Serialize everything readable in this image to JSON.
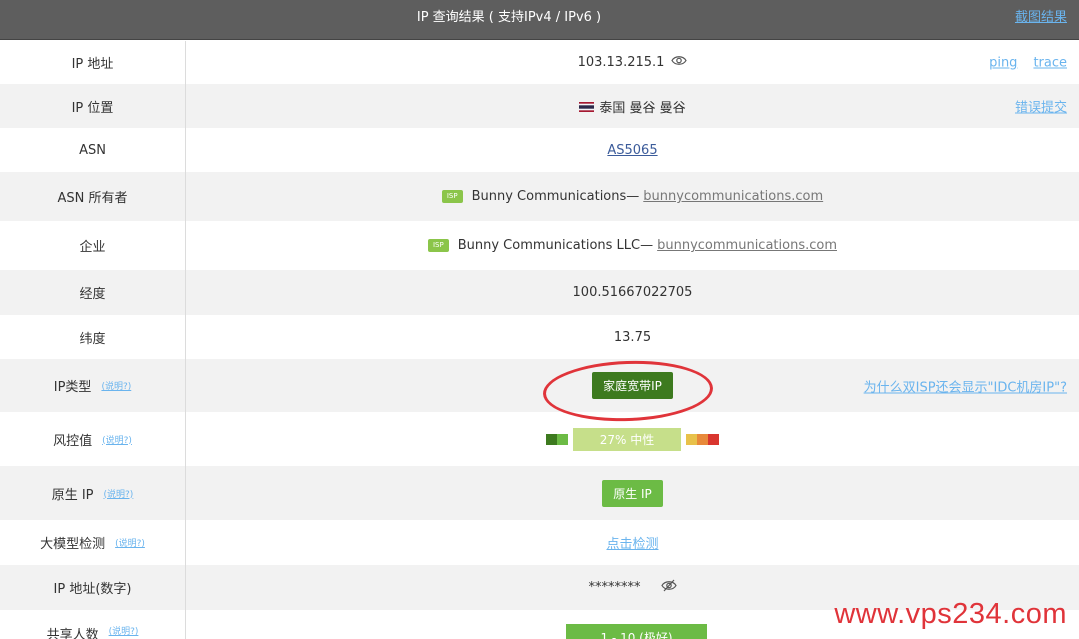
{
  "header": {
    "title": "IP 查询结果 ( 支持IPv4 / IPv6 )",
    "screenshot_link": "截图结果"
  },
  "rows": {
    "ip": {
      "label": "IP 地址",
      "value": "103.13.215.1",
      "ping": "ping",
      "trace": "trace"
    },
    "location": {
      "label": "IP 位置",
      "value": "泰国 曼谷 曼谷",
      "report": "错误提交"
    },
    "asn": {
      "label": "ASN",
      "value": "AS5065"
    },
    "asn_owner": {
      "label": "ASN 所有者",
      "badge": "ISP",
      "name": "Bunny Communications—",
      "domain": "bunnycommunications.com"
    },
    "company": {
      "label": "企业",
      "badge": "ISP",
      "name": "Bunny Communications LLC—",
      "domain": "bunnycommunications.com"
    },
    "longitude": {
      "label": "经度",
      "value": "100.51667022705"
    },
    "latitude": {
      "label": "纬度",
      "value": "13.75"
    },
    "ip_type": {
      "label": "IP类型",
      "help": "(说明?)",
      "value": "家庭宽带IP",
      "why_link": "为什么双ISP还会显示\"IDC机房IP\"?"
    },
    "risk": {
      "label": "风控值",
      "help": "(说明?)",
      "value": "27%  中性"
    },
    "native": {
      "label": "原生 IP",
      "help": "(说明?)",
      "value": "原生 IP"
    },
    "llm": {
      "label": "大模型检测",
      "help": "(说明?)",
      "value": "点击检测"
    },
    "ip_numeric": {
      "label": "IP 地址(数字)",
      "value": "********"
    },
    "shared": {
      "label": "共享人数",
      "help": "(说明?)",
      "value": "1 - 10 (极好)"
    }
  },
  "watermark": "www.vps234.com",
  "colors": {
    "header_bg": "#5e5e5e",
    "link": "#6ab4ee",
    "ip_type_button": "#3d7a1f",
    "annotation_oval": "#e0343a",
    "risk_bar": "#c6df8a",
    "green_button": "#6cbb45"
  }
}
